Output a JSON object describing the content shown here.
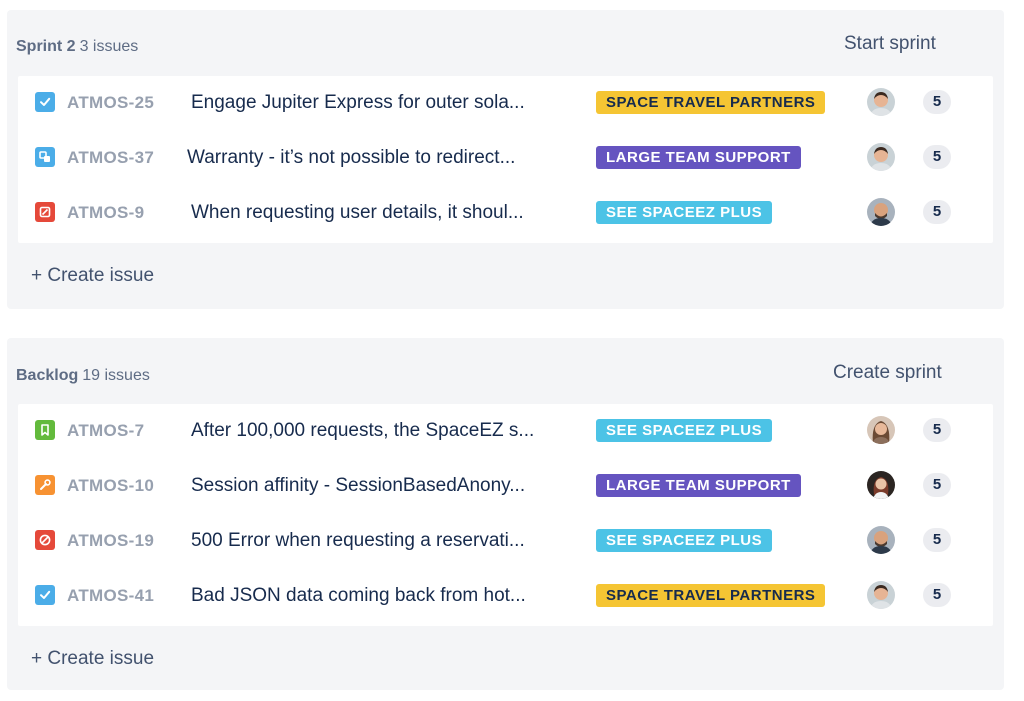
{
  "colors": {
    "section_bg": "#f4f5f7",
    "yellow_epic": "#f5c533",
    "purple_epic": "#6554c0",
    "teal_epic": "#4cc3e6",
    "story_green": "#63ba3c",
    "task_blue": "#4bade8",
    "bug_red": "#e5493a",
    "improvement_orange": "#f79232"
  },
  "sprint": {
    "name": "Sprint 2",
    "count_label": "3 issues",
    "action_label": "Start sprint",
    "create_label": "+ Create issue",
    "issues": [
      {
        "type_icon": "checkbox-task-icon",
        "key": "ATMOS-25",
        "summary": "Engage Jupiter Express for outer sola...",
        "epic": "SPACE TRAVEL PARTNERS",
        "points": "5"
      },
      {
        "type_icon": "subtask-icon",
        "key": "ATMOS-37",
        "summary": "Warranty - it’s not possible to redirect...",
        "epic": "LARGE TEAM SUPPORT",
        "points": "5"
      },
      {
        "type_icon": "bug-icon",
        "key": "ATMOS-9",
        "summary": "When requesting user details, it shoul...",
        "epic": "SEE SPACEEZ PLUS",
        "points": "5"
      }
    ]
  },
  "backlog": {
    "name": "Backlog",
    "count_label": "19 issues",
    "action_label": "Create sprint",
    "create_label": "+ Create issue",
    "issues": [
      {
        "type_icon": "story-bookmark-icon",
        "key": "ATMOS-7",
        "summary": "After 100,000 requests, the SpaceEZ s...",
        "epic": "SEE SPACEEZ PLUS",
        "points": "5"
      },
      {
        "type_icon": "wrench-improvement-icon",
        "key": "ATMOS-10",
        "summary": "Session affinity - SessionBasedAnony...",
        "epic": "LARGE TEAM SUPPORT",
        "points": "5"
      },
      {
        "type_icon": "blocker-icon",
        "key": "ATMOS-19",
        "summary": "500 Error when requesting a reservati...",
        "epic": "SEE SPACEEZ PLUS",
        "points": "5"
      },
      {
        "type_icon": "checkbox-task-icon",
        "key": "ATMOS-41",
        "summary": "Bad JSON data coming back from hot...",
        "epic": "SPACE TRAVEL PARTNERS",
        "points": "5"
      }
    ]
  }
}
